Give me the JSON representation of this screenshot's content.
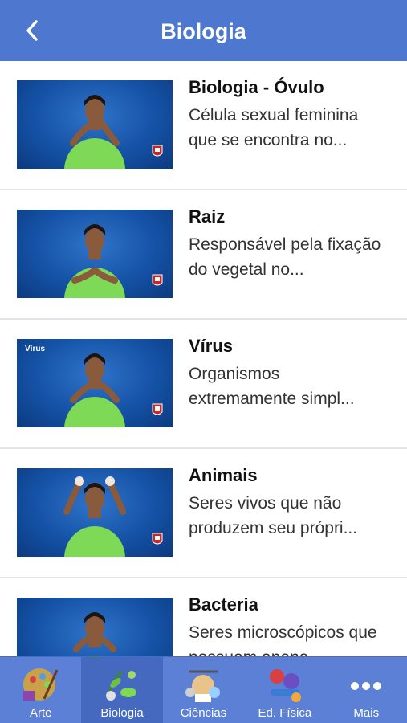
{
  "header": {
    "title": "Biologia"
  },
  "items": [
    {
      "name": "Biologia - Óvulo",
      "description": "Célula sexual feminina que se encontra no...",
      "video_title": ""
    },
    {
      "name": "Raiz",
      "description": "Responsável pela fixação do vegetal no...",
      "video_title": ""
    },
    {
      "name": "Vírus",
      "description": "Organismos extremamente simpl...",
      "video_title": "Vírus"
    },
    {
      "name": "Animais",
      "description": "Seres vivos que não produzem seu própri...",
      "video_title": ""
    },
    {
      "name": "Bacteria",
      "description": "Seres microscópicos que possuem apena...",
      "video_title": ""
    }
  ],
  "tabs": [
    {
      "label": "Arte",
      "icon": "art-icon"
    },
    {
      "label": "Biologia",
      "icon": "biology-icon",
      "active": true
    },
    {
      "label": "Ciências",
      "icon": "science-icon"
    },
    {
      "label": "Ed. Física",
      "icon": "physical-education-icon"
    },
    {
      "label": "Mais",
      "icon": "more-icon"
    }
  ],
  "colors": {
    "nav_bar": "#4e77cf",
    "tab_bar": "#5b80d6",
    "tab_active": "#4469bf",
    "video_background": "#1552a6",
    "shirt": "#7ed957"
  }
}
